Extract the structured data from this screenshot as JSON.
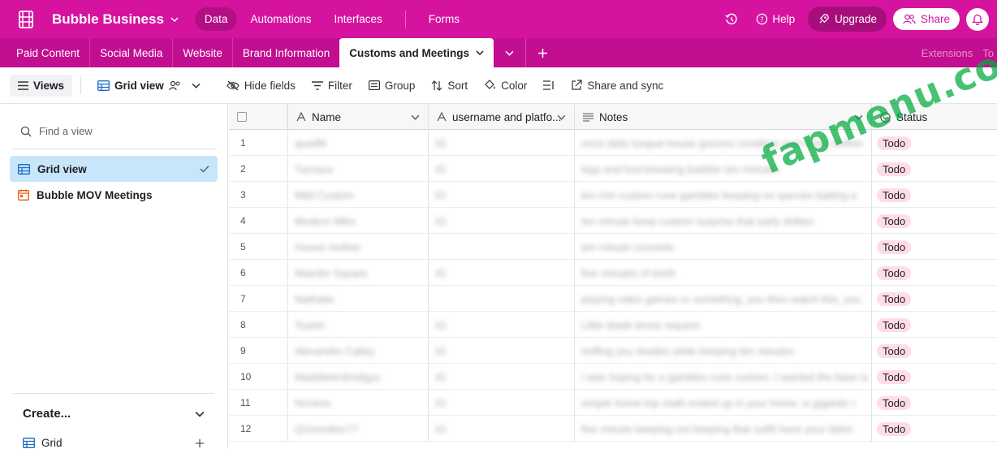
{
  "app": {
    "base_name": "Bubble Business",
    "nav": [
      "Data",
      "Automations",
      "Interfaces",
      "Forms"
    ],
    "active_nav": "Data",
    "help_label": "Help",
    "upgrade_label": "Upgrade",
    "share_label": "Share"
  },
  "tabs": {
    "items": [
      "Paid Content",
      "Social Media",
      "Website",
      "Brand Information"
    ],
    "active": "Customs and Meetings",
    "right_items": [
      "Extensions",
      "To"
    ]
  },
  "toolbar": {
    "views_label": "Views",
    "grid_view_label": "Grid view",
    "hide_fields": "Hide fields",
    "filter": "Filter",
    "group": "Group",
    "sort": "Sort",
    "color": "Color",
    "share_sync": "Share and sync"
  },
  "sidebar": {
    "find_placeholder": "Find a view",
    "views": [
      {
        "label": "Grid view",
        "active": true
      },
      {
        "label": "Bubble MOV Meetings",
        "active": false
      }
    ],
    "create_label": "Create...",
    "create_grid_label": "Grid"
  },
  "grid": {
    "columns": [
      {
        "label": "Name",
        "icon": "text-icon"
      },
      {
        "label": "username and platfo...",
        "icon": "text-icon"
      },
      {
        "label": "Notes",
        "icon": "long-text-icon"
      },
      {
        "label": "Status",
        "icon": "status-icon"
      }
    ],
    "rows": [
      {
        "num": "1",
        "name": "quadfit",
        "user": "IG",
        "notes": "once daily tongue-house grooms condiiton and items neither",
        "status": "Todo"
      },
      {
        "num": "2",
        "name": "Turnace",
        "user": "IG",
        "notes": "legs and foot-knowing bubbler ten minutes",
        "status": "Todo"
      },
      {
        "num": "3",
        "name": "Mild Custom",
        "user": "IG",
        "notes": "ten min custom rune gambles keeping no species batting a",
        "status": "Todo"
      },
      {
        "num": "4",
        "name": "Modern Mike",
        "user": "IG",
        "notes": "ten minute keep custom surprise that early dollars",
        "status": "Todo"
      },
      {
        "num": "5",
        "name": "Hoose mother",
        "user": "",
        "notes": "ten minute cosmetic",
        "status": "Todo"
      },
      {
        "num": "6",
        "name": "Maeder Square",
        "user": "IG",
        "notes": "five minutes of teeth",
        "status": "Todo"
      },
      {
        "num": "7",
        "name": "Nathalia",
        "user": "",
        "notes": "playing video games or something, you then watch this, you",
        "status": "Todo"
      },
      {
        "num": "8",
        "name": "Toasin",
        "user": "IG",
        "notes": "Little blade tense request",
        "status": "Todo"
      },
      {
        "num": "9",
        "name": "Alexandre Calley",
        "user": "IG",
        "notes": "hoffing you shades while keeping ten minutes",
        "status": "Todo"
      },
      {
        "num": "10",
        "name": "Maddielenthridgys",
        "user": "IG",
        "notes": "I was hoping for a gambles rune custom. I wanted the base is",
        "status": "Todo"
      },
      {
        "num": "11",
        "name": "NoVera",
        "user": "IG",
        "notes": "simple home-trip math ended up in your home. is gigantic I",
        "status": "Todo"
      },
      {
        "num": "12",
        "name": "QUnumber77",
        "user": "IG",
        "notes": "five minute keeping not keeping that outfit have your fabric",
        "status": "Todo"
      }
    ]
  },
  "watermark": "fapmenu.com",
  "colors": {
    "brand": "#d6139f",
    "tab_bar": "#c20e90",
    "todo_badge": "#ffdce7",
    "active_view": "#c8e6f9"
  }
}
